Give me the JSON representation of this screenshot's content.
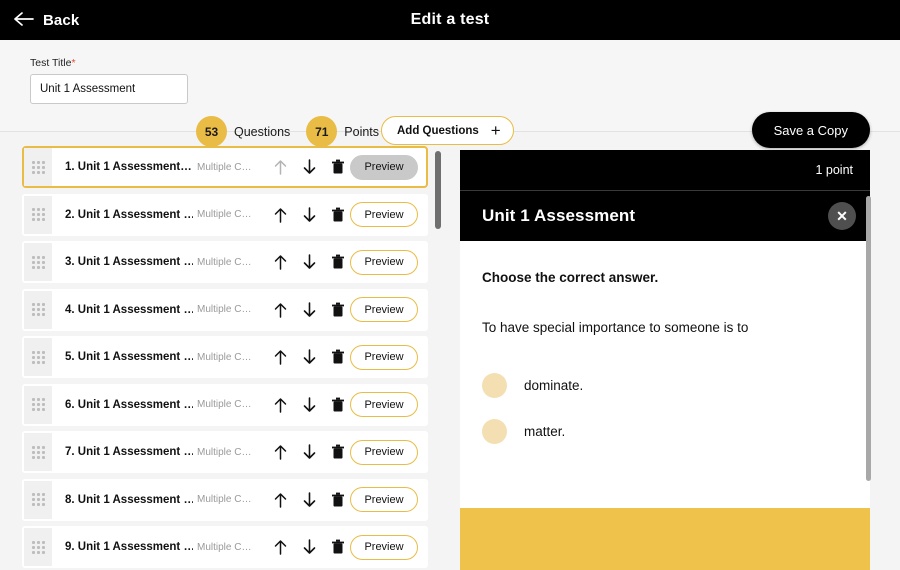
{
  "header": {
    "back_label": "Back",
    "title": "Edit a test",
    "back_icon": "arrow-left-icon"
  },
  "toolbar": {
    "title_field_label": "Test Title",
    "required_marker": "*",
    "title_value": "Unit 1 Assessment",
    "title_placeholder": "Test Title",
    "questions_count": "53",
    "questions_label": "Questions",
    "points_count": "71",
    "points_label": "Points",
    "add_questions_label": "Add Questions",
    "add_questions_icon": "plus-icon",
    "save_copy_label": "Save a Copy"
  },
  "question_list": {
    "row_icons": {
      "drag": "drag-handle-icon",
      "move_up": "arrow-up-icon",
      "move_down": "arrow-down-icon",
      "delete": "trash-icon"
    },
    "preview_label": "Preview",
    "rows": [
      {
        "title": "1. Unit 1 Assessment…",
        "type": "Multiple C…",
        "selected": true
      },
      {
        "title": "2. Unit 1 Assessment …",
        "type": "Multiple C…",
        "selected": false
      },
      {
        "title": "3. Unit 1 Assessment …",
        "type": "Multiple C…",
        "selected": false
      },
      {
        "title": "4. Unit 1 Assessment …",
        "type": "Multiple C…",
        "selected": false
      },
      {
        "title": "5. Unit 1 Assessment …",
        "type": "Multiple C…",
        "selected": false
      },
      {
        "title": "6. Unit 1 Assessment …",
        "type": "Multiple C…",
        "selected": false
      },
      {
        "title": "7. Unit 1 Assessment …",
        "type": "Multiple C…",
        "selected": false
      },
      {
        "title": "8. Unit 1 Assessment …",
        "type": "Multiple C…",
        "selected": false
      },
      {
        "title": "9. Unit 1 Assessment …",
        "type": "Multiple C…",
        "selected": false
      }
    ]
  },
  "preview_panel": {
    "points_text": "1 point",
    "title": "Unit 1 Assessment",
    "close_icon": "close-icon",
    "close_glyph": "✕",
    "instruction": "Choose the correct answer.",
    "stem": "To have special importance to someone is to",
    "options": [
      {
        "label": "dominate."
      },
      {
        "label": "matter."
      }
    ]
  },
  "colors": {
    "accent_gold": "#e9bc45",
    "footer_yellow": "#efc24b",
    "option_circle": "#f4dfb2",
    "header_black": "#000000",
    "page_bg": "#f4f4f4"
  }
}
